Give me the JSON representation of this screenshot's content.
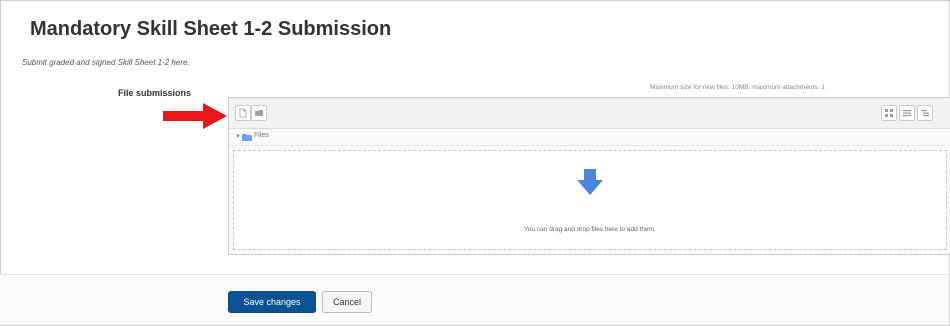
{
  "page": {
    "title": "Mandatory Skill Sheet 1-2 Submission",
    "intro": "Submit graded and signed Skill Sheet 1-2 here."
  },
  "file_submissions": {
    "label": "File submissions",
    "limits": "Maximum size for new files: 10MB, maximum attachments: 1",
    "path_label": "Files",
    "drop_text": "You can drag and drop files here to add them.",
    "icons": {
      "add": "add-file-icon",
      "create_folder": "create-folder-icon",
      "view_icons": "view-icons-icon",
      "view_list": "view-list-icon",
      "view_tree": "view-tree-icon",
      "path_folder": "folder-icon",
      "drop_arrow": "down-arrow-icon",
      "annotation_arrow": "red-arrow-icon"
    }
  },
  "actions": {
    "save_label": "Save changes",
    "cancel_label": "Cancel"
  },
  "colors": {
    "primary_button": "#0b5394",
    "drop_arrow": "#4a86d9",
    "annotation_arrow": "#e8151b",
    "folder": "#6ea5e0"
  }
}
